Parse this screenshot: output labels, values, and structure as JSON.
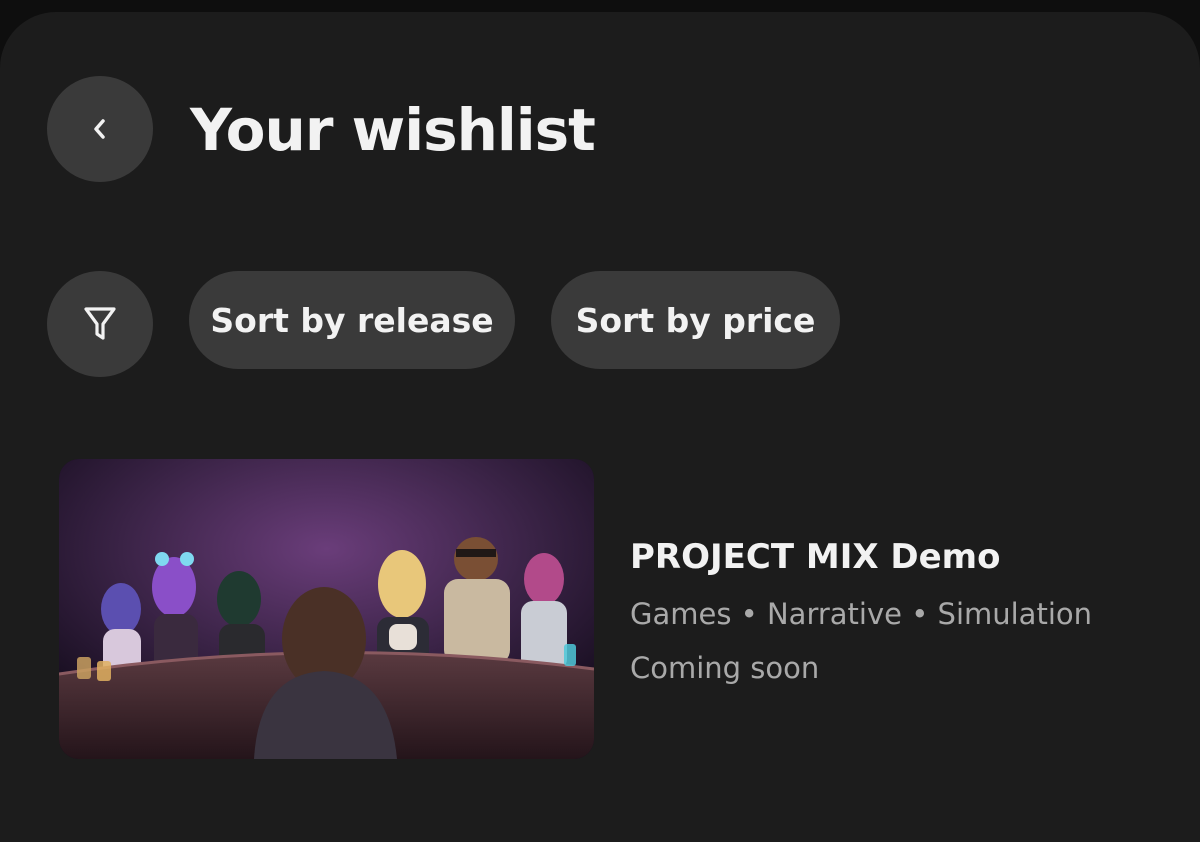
{
  "header": {
    "title": "Your wishlist",
    "back_icon": "chevron-left-icon"
  },
  "toolbar": {
    "filter_icon": "filter-icon",
    "sort_release_label": "Sort by release",
    "sort_price_label": "Sort by price"
  },
  "wishlist": {
    "items": [
      {
        "title": "PROJECT MIX Demo",
        "tags": "Games • Narrative • Simulation",
        "status": "Coming soon"
      }
    ]
  },
  "colors": {
    "background": "#1c1c1c",
    "button": "#3a3a3a",
    "text_primary": "#f2f2f2",
    "text_secondary": "#a9a9a9"
  }
}
